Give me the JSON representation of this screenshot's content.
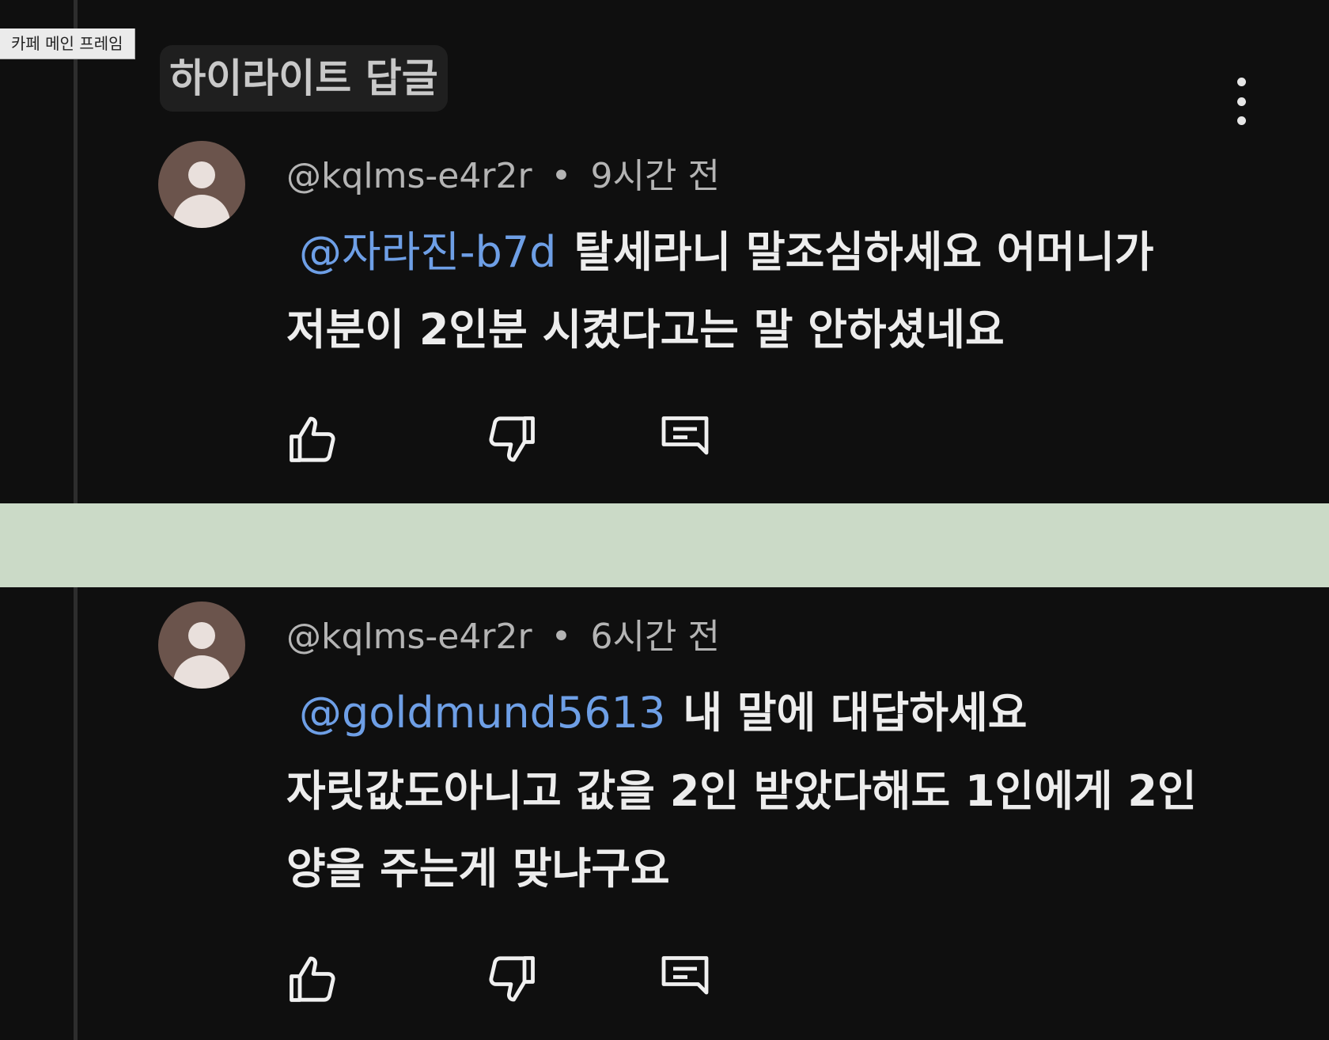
{
  "frame_label": "카페 메인 프레임",
  "highlight_chip": "하이라이트 답글",
  "comments": [
    {
      "author": "@kqlms-e4r2r",
      "separator": "•",
      "time": "9시간 전",
      "mention": "@자라진-b7d",
      "lines": [
        "탈세라니 말조심하세요 어머니가",
        "저분이 2인분 시켰다고는 말 안하셨네요"
      ]
    },
    {
      "author": "@kqlms-e4r2r",
      "separator": "•",
      "time": "6시간 전",
      "mention": "@goldmund5613",
      "lines": [
        "내 말에 대답하세요",
        "자릿값도아니고 값을 2인 받았다해도 1인에게 2인",
        "양을 주는게 맞냐구요"
      ]
    }
  ],
  "icons": [
    "more-vert-icon",
    "avatar-icon",
    "like-icon",
    "dislike-icon",
    "reply-icon"
  ],
  "colors": {
    "background": "#0f0f0f",
    "mention": "#6e9fe6",
    "divider_band": "#cbdac7",
    "avatar": "#6b544c"
  }
}
